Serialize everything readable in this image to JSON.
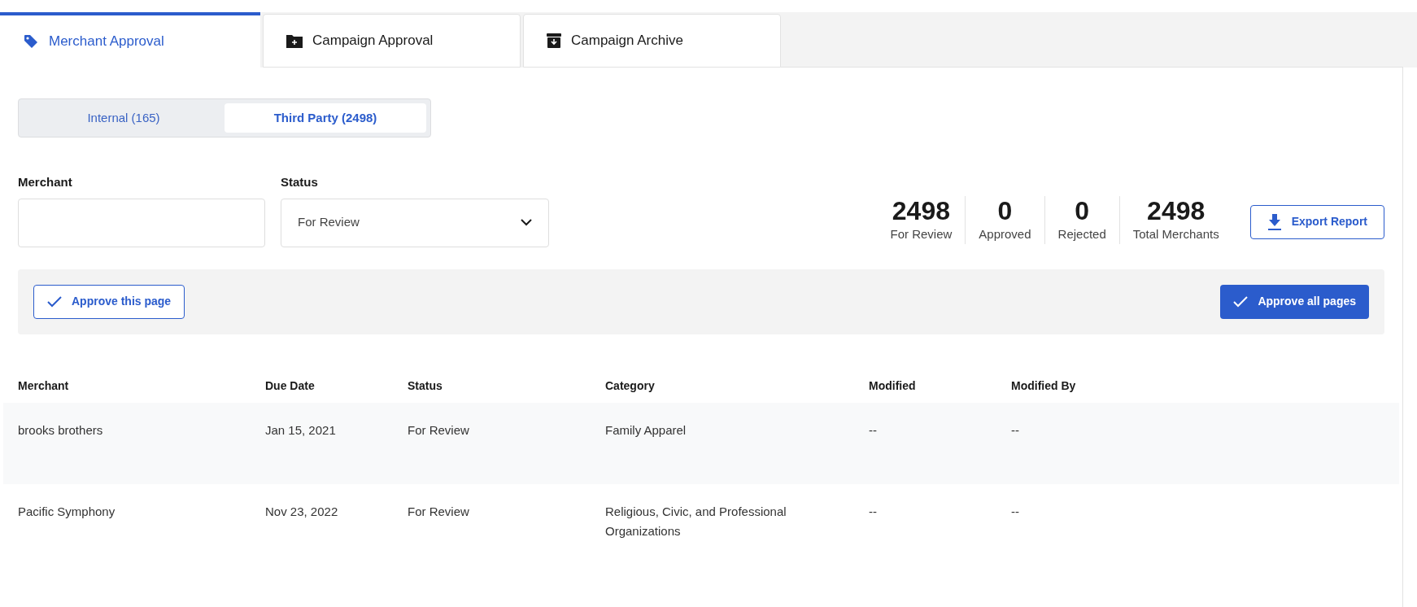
{
  "tabs": [
    {
      "label": "Merchant Approval",
      "kind": "tag",
      "selected": true
    },
    {
      "label": "Campaign Approval",
      "kind": "folder",
      "selected": false
    },
    {
      "label": "Campaign Archive",
      "kind": "archive",
      "selected": false
    }
  ],
  "segments": [
    {
      "label": "Internal (165)",
      "selected": false
    },
    {
      "label": "Third Party (2498)",
      "selected": true
    }
  ],
  "filters": {
    "merchant": {
      "label": "Merchant"
    },
    "status": {
      "label": "Status",
      "value": "For Review"
    }
  },
  "stats": [
    {
      "value": "2498",
      "label": "For Review"
    },
    {
      "value": "0",
      "label": "Approved"
    },
    {
      "value": "0",
      "label": "Rejected"
    },
    {
      "value": "2498",
      "label": "Total Merchants"
    }
  ],
  "export_button": "Export Report",
  "approve_page_button": "Approve this page",
  "approve_all_button": "Approve all pages",
  "table": {
    "columns": [
      "Merchant",
      "Due Date",
      "Status",
      "Category",
      "Modified",
      "Modified By"
    ],
    "rows": [
      [
        "brooks brothers",
        "Jan 15, 2021",
        "For Review",
        "Family Apparel",
        "--",
        "--"
      ],
      [
        "Pacific Symphony",
        "Nov 23, 2022",
        "For Review",
        "Religious, Civic, and Professional Organizations",
        "--",
        "--"
      ]
    ]
  }
}
